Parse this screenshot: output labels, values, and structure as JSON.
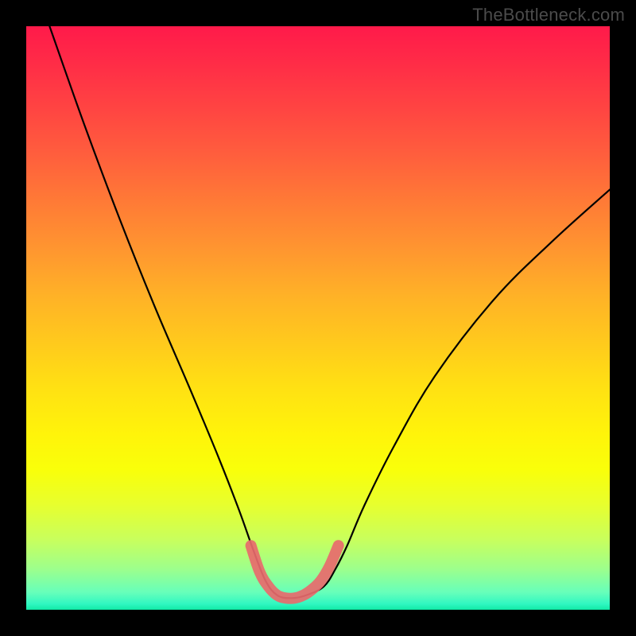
{
  "watermark": {
    "text": "TheBottleneck.com"
  },
  "colors": {
    "curve_black": "#000000",
    "highlight_pink": "#e86a6d",
    "frame": "#000000"
  },
  "chart_data": {
    "type": "line",
    "title": "",
    "xlabel": "",
    "ylabel": "",
    "xlim": [
      0,
      100
    ],
    "ylim": [
      0,
      100
    ],
    "grid": false,
    "legend": false,
    "series": [
      {
        "name": "bottleneck-curve",
        "x": [
          4,
          10,
          16,
          22,
          28,
          33,
          36.5,
          39,
          41,
          43,
          45.5,
          48,
          51,
          53,
          55,
          58,
          63,
          70,
          80,
          90,
          100
        ],
        "y": [
          100,
          83,
          67,
          52,
          38,
          26,
          17,
          10,
          5,
          2.5,
          2,
          2.5,
          4,
          7,
          11,
          18,
          28,
          40,
          53,
          63,
          72
        ]
      },
      {
        "name": "highlight-segment",
        "x": [
          38.5,
          40,
          41.5,
          43,
          44.5,
          46,
          47.5,
          49,
          50.5,
          52,
          53.5
        ],
        "y": [
          11,
          6.5,
          4,
          2.5,
          2,
          2,
          2.5,
          3.5,
          5,
          7.5,
          11
        ]
      }
    ],
    "annotations": []
  }
}
